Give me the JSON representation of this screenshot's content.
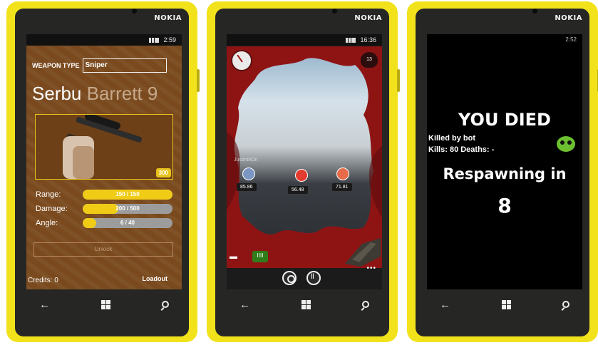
{
  "device_brand": "NOKIA",
  "screen1": {
    "status_time": "2:59",
    "weapon_type_label": "WEAPON TYPE",
    "weapon_type_value": "Sniper",
    "weapon_name": "Serbu",
    "weapon_name_alt": "Barrett 9",
    "price": "300",
    "stats": [
      {
        "label": "Range:",
        "value": "150 / 150",
        "fill": 1.0
      },
      {
        "label": "Damage:",
        "value": "200 / 500",
        "fill": 0.4
      },
      {
        "label": "Angle:",
        "value": "6 / 40",
        "fill": 0.15
      }
    ],
    "unlock_label": "Unlock",
    "credits": "Credits: 0",
    "loadout_label": "Loadout"
  },
  "screen2": {
    "status_time": "16:36",
    "heart_count": "13",
    "players": [
      {
        "name": "JustinthOn",
        "score": "85.86"
      },
      {
        "name": "",
        "score": "56.48"
      },
      {
        "name": "",
        "score": "71.81"
      }
    ],
    "ammo_label": "IIII",
    "more_label": "•••"
  },
  "screen3": {
    "status_time": "2:52",
    "title": "YOU DIED",
    "killed_by": "Killed by bot",
    "kills_deaths": "Kills: 80 Deaths: -",
    "respawn_label": "Respawning in",
    "countdown": "8"
  }
}
